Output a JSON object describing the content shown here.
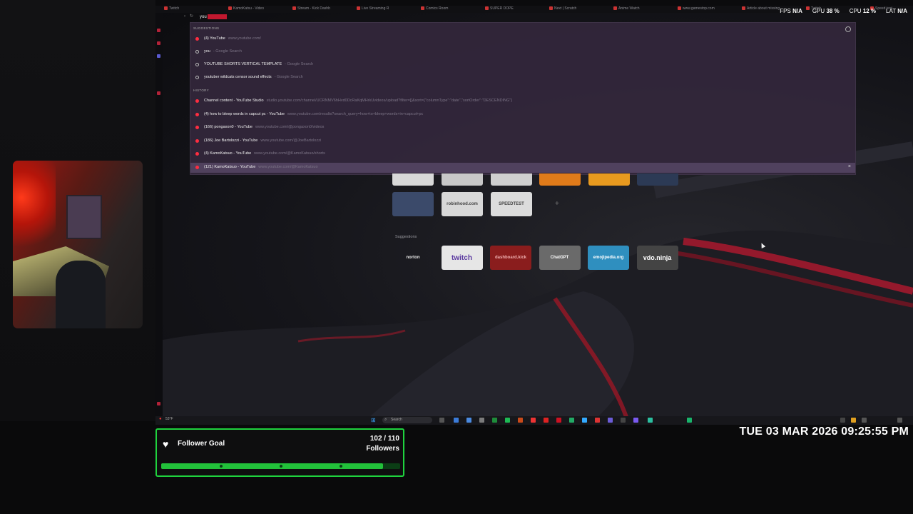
{
  "browser": {
    "tabs": [
      "Twitch",
      "KamoKatsu - Video",
      "Stream - Kick Dashb",
      "Live Streaming R",
      "Comics Room",
      "SUPER DOPE",
      "Next | Scratch",
      "Anime Watch",
      "www.gamestop.com",
      "Article about missing",
      "Twitch",
      "Speed test"
    ],
    "url_input_value": "you",
    "url_highlight": "tube.com",
    "accent": "#c2182f"
  },
  "dropdown": {
    "suggestions_header": "SUGGESTIONS",
    "history_header": "HISTORY",
    "suggestions": [
      {
        "title": "(4) YouTube",
        "sub": "www.youtube.com/",
        "icon": "youtube-icon"
      },
      {
        "title": "you",
        "sub": "- Google Search",
        "icon": "search-icon"
      },
      {
        "title": "YOUTUBE SHORTS VERTICAL TEMPLATE",
        "sub": "- Google Search",
        "icon": "search-icon"
      },
      {
        "title": "youtuber wildcats censor sound effects",
        "sub": "- Google Search",
        "icon": "search-icon"
      }
    ],
    "history": [
      {
        "title": "Channel content - YouTube Studio",
        "sub": "studio.youtube.com/channel/UCRNMV6hHvd0DcRaKqMHrkUvideos/upload?filter=[]&sort={\"columnType\":\"date\",\"sortOrder\":\"DESCENDING\"}"
      },
      {
        "title": "(4) how to bleep words in capcut pc - YouTube",
        "sub": "www.youtube.com/results?search_query=how+to+bleep+words+in+capcut+pc"
      },
      {
        "title": "(166) pongaxon0 - YouTube",
        "sub": "www.youtube.com/@pongaxon0/videos"
      },
      {
        "title": "(186) Joe Bartolozzi - YouTube",
        "sub": "www.youtube.com/@JoeBartolozzi"
      },
      {
        "title": "(4) KamoKatsuo - YouTube",
        "sub": "www.youtube.com/@KamoKatsuo/shorts"
      },
      {
        "title": "(121) KamoKatsuo - YouTube",
        "sub": "www.youtube.com/@KamoKatsuo"
      }
    ]
  },
  "speed_dials": {
    "row2": [
      {
        "label": "",
        "bg": "#3b4a6a"
      },
      {
        "label": "robinhood.com",
        "bg": "#d8d8d8"
      },
      {
        "label": "SPEEDTEST",
        "bg": "#dcdcdc"
      }
    ],
    "suggestions_label": "Suggestions",
    "suggestions": [
      {
        "label": "norton",
        "bg": "transparent",
        "fg": "#e8e8e8"
      },
      {
        "label": "twitch",
        "bg": "#e6e6e6",
        "fg": "#5b3aa0"
      },
      {
        "label": "dashboard.kick",
        "bg": "#8a1d1d",
        "fg": "#f0b0b0"
      },
      {
        "label": "ChatGPT",
        "bg": "#6a6a6a",
        "fg": "#fff"
      },
      {
        "label": "emojipedia.org",
        "bg": "#2f8fbf",
        "fg": "#fff"
      },
      {
        "label": "vdo.ninja",
        "bg": "#444",
        "fg": "#fff"
      }
    ]
  },
  "hud": {
    "fps_label": "FPS",
    "fps_value": "N/A",
    "gpu_label": "GPU",
    "gpu_value": "38 %",
    "cpu_label": "CPU",
    "cpu_value": "12 %",
    "lat_label": "LAT",
    "lat_value": "N/A"
  },
  "taskbar": {
    "weather": "53°F",
    "search_placeholder": "Search"
  },
  "follower_goal": {
    "title": "Follower Goal",
    "count": "102 / 110",
    "unit": "Followers",
    "progress": 0.927,
    "color": "#22c13a"
  },
  "clock": "TUE 03 MAR 2026 09:25:55 PM"
}
